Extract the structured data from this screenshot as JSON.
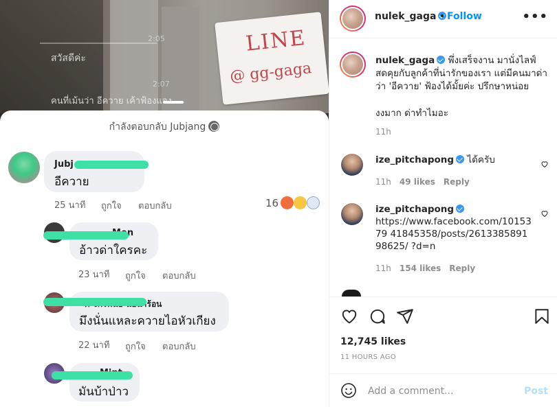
{
  "media": {
    "sign_line1": "LINE",
    "sign_line2": "@ gg-gaga",
    "ghost_greeting": "สวัสดีค่ะ",
    "ghost_time1": "2:05",
    "ghost_time2": "2:07",
    "ghost_caption": "คนที่เม้นว่า อีควาย เค้าฟ้องแจง",
    "reply_header": "กำลังตอบกลับ Jubjang",
    "comments": [
      {
        "name": "Jubj",
        "text": "อีควาย",
        "time": "25 นาที",
        "like": "ถูกใจ",
        "reply": "ตอบกลับ",
        "reactions": "16"
      },
      {
        "name": "Mon",
        "text": "อ้าวด่าใครคะ",
        "time": "23 นาที",
        "like": "ถูกใจ",
        "reply": "ตอบกลับ"
      },
      {
        "name": "ศ จักรพันธ์ น่อน้ำร้อน",
        "text": "มึงนั่นแหละควายไอหัวเกียง",
        "time": "22 นาที",
        "like": "ถูกใจ",
        "reply": "ตอบกลับ"
      },
      {
        "name": "Mint",
        "text": "มันบ้าป่าว"
      }
    ]
  },
  "header": {
    "username": "nulek_gaga",
    "separator": "•",
    "follow_label": "Follow",
    "more_label": "•••"
  },
  "caption": {
    "username": "nulek_gaga",
    "text": "พึ่งเสร็จงาน มานั่งไลฟ์สดคุยกับลูกค้าที่น่ารักของเรา แต่มีคนมาด่าว่า 'อีควาย' ฟ้องได้มั้ยค่ะ ปรึกษาหน่อย",
    "text2": "งงมาก ด่าทำไมอะ",
    "time": "11h"
  },
  "comments": [
    {
      "username": "ize_pitchapong",
      "text": "ได้ครับ",
      "time": "11h",
      "likes": "49 likes",
      "reply": "Reply"
    },
    {
      "username": "ize_pitchapong",
      "text": "https://www.facebook.com/1015379 41845358/posts/261338589198625/ ?d=n",
      "time": "11h",
      "likes": "154 likes",
      "reply": "Reply"
    }
  ],
  "footer": {
    "likes": "12,745 likes",
    "ago": "11 HOURS AGO",
    "comment_placeholder": "Add a comment...",
    "post_label": "Post"
  },
  "icons": {
    "heart": "heart-icon",
    "comment": "comment-icon",
    "share": "share-icon",
    "save": "bookmark-icon",
    "emoji": "emoji-icon"
  },
  "colors": {
    "link_blue": "#0095f6",
    "mask_green": "#3ee0a6"
  }
}
